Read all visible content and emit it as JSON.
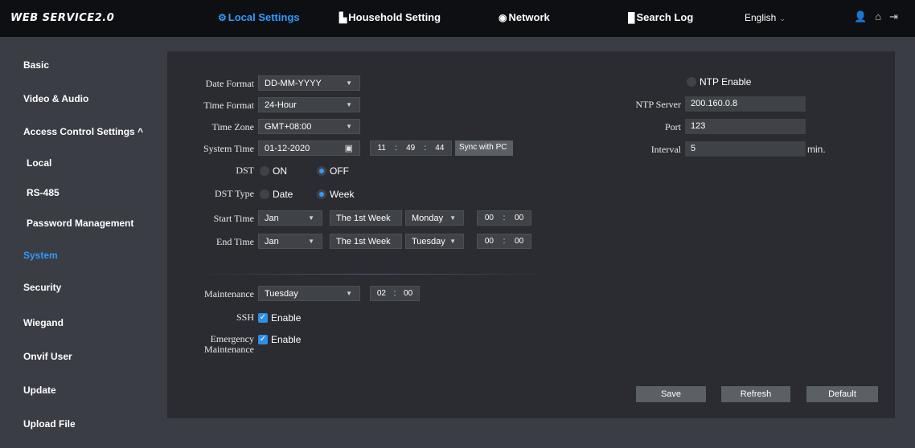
{
  "header": {
    "brand": "WEB SERVICE2.0",
    "nav": [
      {
        "label": "Local Settings",
        "icon": "gear-icon"
      },
      {
        "label": "Household Setting",
        "icon": "building-icon"
      },
      {
        "label": "Network",
        "icon": "globe-icon"
      },
      {
        "label": "Search Log",
        "icon": "document-icon"
      }
    ],
    "language": "English",
    "icons": [
      "user-icon",
      "home-icon",
      "logout-icon"
    ]
  },
  "sidebar": {
    "items": [
      "Basic",
      "Video & Audio",
      "Access Control Settings  ^",
      "Local",
      "RS-485",
      "Password Management",
      "System",
      "Security",
      "Wiegand",
      "Onvif User",
      "Update",
      "Upload File"
    ],
    "active": "System"
  },
  "form": {
    "date_format": {
      "label": "Date Format",
      "value": "DD-MM-YYYY"
    },
    "time_format": {
      "label": "Time Format",
      "value": "24-Hour"
    },
    "time_zone": {
      "label": "Time Zone",
      "value": "GMT+08:00"
    },
    "system_time": {
      "label": "System Time",
      "date": "01-12-2020",
      "hh": "11",
      "mm": "49",
      "ss": "44",
      "sync_label": "Sync with PC"
    },
    "dst": {
      "label": "DST",
      "on": "ON",
      "off": "OFF",
      "selected": "OFF"
    },
    "dst_type": {
      "label": "DST Type",
      "date": "Date",
      "week": "Week",
      "selected": "Week"
    },
    "start_time": {
      "label": "Start Time",
      "month": "Jan",
      "week": "The 1st Week",
      "day": "Monday",
      "hh": "00",
      "mm": "00"
    },
    "end_time": {
      "label": "End Time",
      "month": "Jan",
      "week": "The 1st Week",
      "day": "Tuesday",
      "hh": "00",
      "mm": "00"
    },
    "maintenance": {
      "label": "Maintenance",
      "day": "Tuesday",
      "hh": "02",
      "mm": "00"
    },
    "ssh": {
      "label": "SSH",
      "option": "Enable",
      "checked": true
    },
    "emergency": {
      "label_line1": "Emergency",
      "label_line2": "Maintenance",
      "option": "Enable",
      "checked": true
    },
    "ntp": {
      "enable_label": "NTP Enable",
      "server_label": "NTP Server",
      "server": "200.160.0.8",
      "port_label": "Port",
      "port": "123",
      "interval_label": "Interval",
      "interval": "5",
      "unit": "min."
    },
    "buttons": {
      "save": "Save",
      "refresh": "Refresh",
      "default": "Default"
    }
  },
  "colors": {
    "accent": "#2e9bff",
    "topbar": "#0e0f12",
    "panel": "#2a2c31",
    "background": "#3a3d44"
  }
}
